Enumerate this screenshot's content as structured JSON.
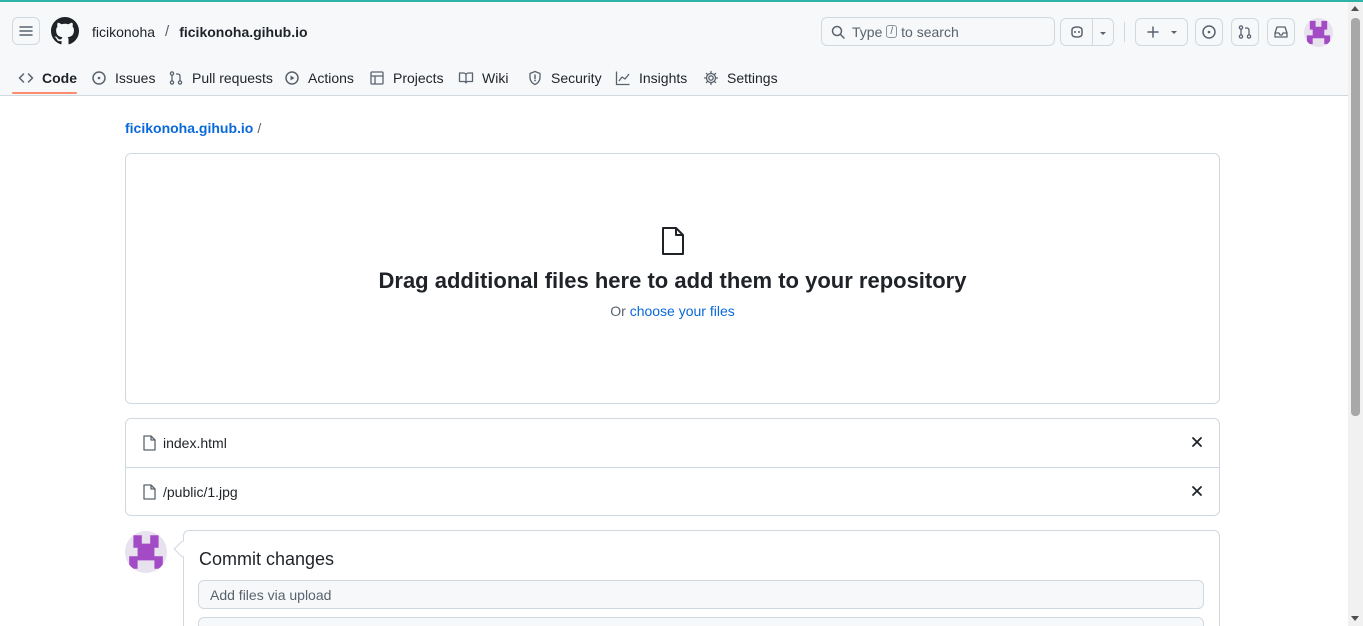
{
  "colors": {
    "accent": "#0969da",
    "tab_underline": "#fd8c73",
    "avatar": "#a24bc5"
  },
  "header": {
    "owner": "ficikonoha",
    "separator": "/",
    "repo": "ficikonoha.gihub.io",
    "search": {
      "prefix": "Type",
      "key": "/",
      "suffix": "to search"
    },
    "icons": [
      "hamburger-icon",
      "github-logo-icon",
      "copilot-icon",
      "plus-icon",
      "issues-icon",
      "pull-requests-icon",
      "inbox-icon"
    ]
  },
  "tabs": [
    {
      "label": "Code",
      "icon": "code-icon",
      "active": true
    },
    {
      "label": "Issues",
      "icon": "issue-icon"
    },
    {
      "label": "Pull requests",
      "icon": "pull-request-icon"
    },
    {
      "label": "Actions",
      "icon": "play-icon"
    },
    {
      "label": "Projects",
      "icon": "table-icon"
    },
    {
      "label": "Wiki",
      "icon": "book-icon"
    },
    {
      "label": "Security",
      "icon": "shield-icon"
    },
    {
      "label": "Insights",
      "icon": "graph-icon"
    },
    {
      "label": "Settings",
      "icon": "gear-icon"
    }
  ],
  "path": {
    "repo": "ficikonoha.gihub.io",
    "slash": "/"
  },
  "dropzone": {
    "title": "Drag additional files here to add them to your repository",
    "sub_prefix": "Or",
    "sub_link": "choose your files"
  },
  "files": [
    {
      "name": "index.html"
    },
    {
      "name": "/public/1.jpg"
    }
  ],
  "commit": {
    "title": "Commit changes",
    "summary_placeholder": "Add files via upload"
  }
}
